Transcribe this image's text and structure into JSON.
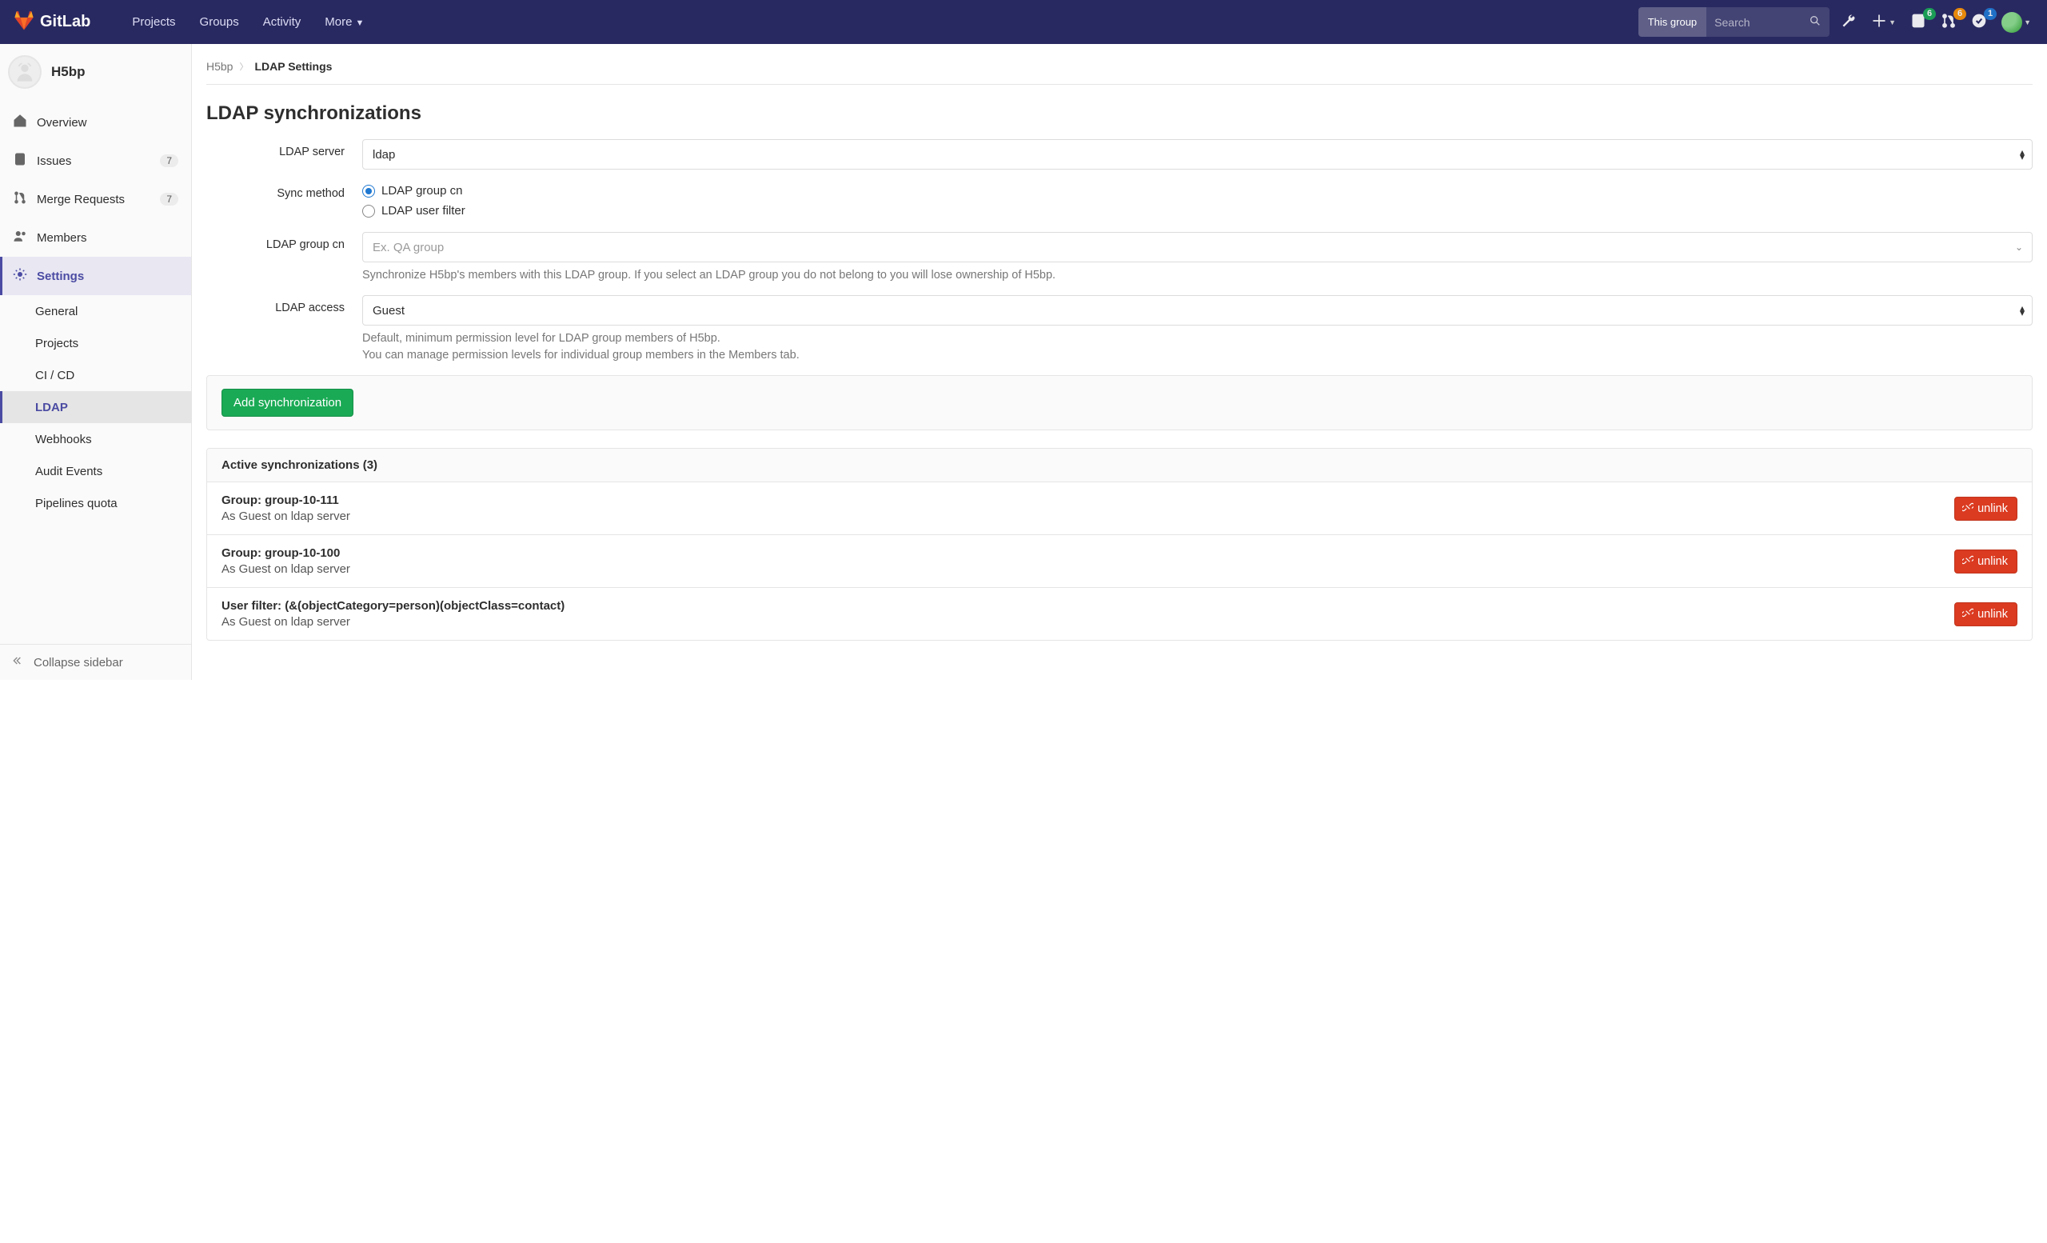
{
  "brand": "GitLab",
  "nav": {
    "links": [
      "Projects",
      "Groups",
      "Activity",
      "More"
    ],
    "search_scope": "This group",
    "search_placeholder": "Search",
    "badge_issues": "6",
    "badge_mr": "6",
    "badge_todos": "1"
  },
  "sidebar": {
    "project": "H5bp",
    "items": {
      "overview": "Overview",
      "issues": {
        "label": "Issues",
        "count": "7"
      },
      "mrs": {
        "label": "Merge Requests",
        "count": "7"
      },
      "members": "Members",
      "settings": "Settings"
    },
    "settings_sub": [
      "General",
      "Projects",
      "CI / CD",
      "LDAP",
      "Webhooks",
      "Audit Events",
      "Pipelines quota"
    ],
    "collapse": "Collapse sidebar"
  },
  "breadcrumb": {
    "root": "H5bp",
    "current": "LDAP Settings"
  },
  "page": {
    "title": "LDAP synchronizations",
    "labels": {
      "server": "LDAP server",
      "method": "Sync method",
      "cn": "LDAP group cn",
      "access": "LDAP access"
    },
    "server_value": "ldap",
    "method_cn": "LDAP group cn",
    "method_filter": "LDAP user filter",
    "cn_placeholder": "Ex. QA group",
    "cn_help": "Synchronize H5bp's members with this LDAP group. If you select an LDAP group you do not belong to you will lose ownership of H5bp.",
    "access_value": "Guest",
    "access_help_1": "Default, minimum permission level for LDAP group members of H5bp.",
    "access_help_2": "You can manage permission levels for individual group members in the Members tab.",
    "add_button": "Add synchronization"
  },
  "syncs": {
    "header": "Active synchronizations (3)",
    "unlink_label": "unlink",
    "rows": [
      {
        "title": "Group: group-10-111",
        "sub": "As Guest on ldap server"
      },
      {
        "title": "Group: group-10-100",
        "sub": "As Guest on ldap server"
      },
      {
        "title": "User filter: (&(objectCategory=person)(objectClass=contact)",
        "sub": "As Guest on ldap server"
      }
    ]
  }
}
